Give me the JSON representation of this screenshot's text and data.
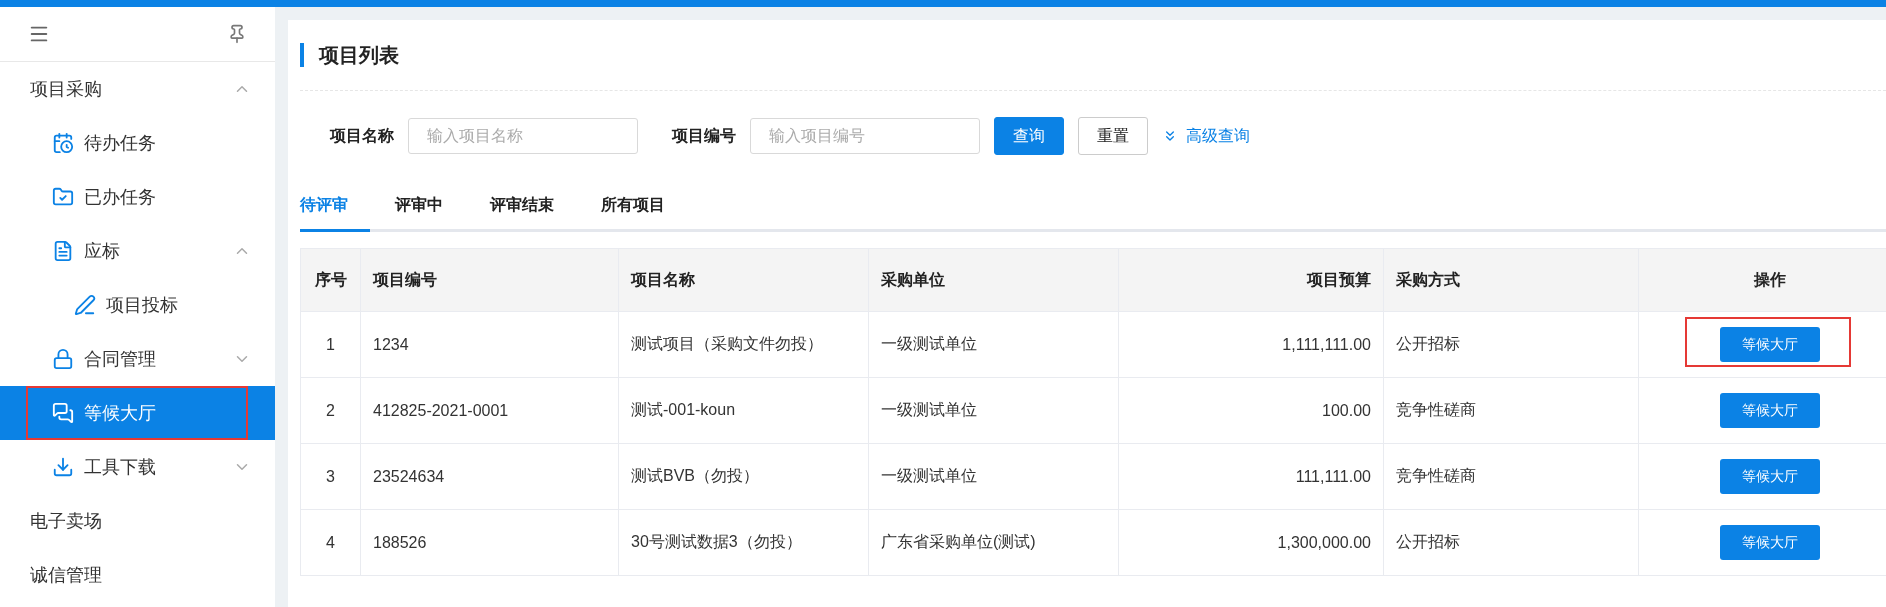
{
  "sidebar": {
    "items": [
      {
        "label": "项目采购",
        "selected": false,
        "expanded": true,
        "children": [
          {
            "label": "待办任务",
            "selected": false
          },
          {
            "label": "已办任务",
            "selected": false
          },
          {
            "label": "应标",
            "selected": false,
            "expanded": true,
            "children": [
              {
                "label": "项目投标",
                "selected": false
              }
            ]
          },
          {
            "label": "合同管理",
            "selected": false,
            "expanded": false
          },
          {
            "label": "等候大厅",
            "selected": true,
            "highlighted": true
          },
          {
            "label": "工具下载",
            "selected": false,
            "expanded": false
          }
        ]
      },
      {
        "label": "电子卖场",
        "selected": false
      },
      {
        "label": "诚信管理",
        "selected": false
      }
    ]
  },
  "page": {
    "title": "项目列表",
    "filters": [
      {
        "label": "项目名称",
        "placeholder": "输入项目名称"
      },
      {
        "label": "项目编号",
        "placeholder": "输入项目编号"
      }
    ],
    "search_button": "查询",
    "reset_button": "重置",
    "advanced_link": "高级查询",
    "tabs": [
      {
        "label": "待评审",
        "selected": true
      },
      {
        "label": "评审中",
        "selected": false
      },
      {
        "label": "评审结束",
        "selected": false
      },
      {
        "label": "所有项目",
        "selected": false
      }
    ],
    "table": {
      "columns": [
        "序号",
        "项目编号",
        "项目名称",
        "采购单位",
        "项目预算",
        "采购方式",
        "操作"
      ],
      "rows": [
        {
          "cells": [
            "1",
            "1234",
            "测试项目（采购文件勿投）",
            "一级测试单位",
            "1,111,111.00",
            "公开招标"
          ],
          "action": "等候大厅",
          "highlighted": true
        },
        {
          "cells": [
            "2",
            "412825-2021-0001",
            "测试-001-koun",
            "一级测试单位",
            "100.00",
            "竞争性磋商"
          ],
          "action": "等候大厅",
          "highlighted": false
        },
        {
          "cells": [
            "3",
            "23524634",
            "测试BVB（勿投）",
            "一级测试单位",
            "111,111.00",
            "竞争性磋商"
          ],
          "action": "等候大厅",
          "highlighted": false
        },
        {
          "cells": [
            "4",
            "188526",
            "30号测试数据3（勿投）",
            "广东省采购单位(测试)",
            "1,300,000.00",
            "公开招标"
          ],
          "action": "等候大厅",
          "highlighted": false
        }
      ]
    }
  }
}
